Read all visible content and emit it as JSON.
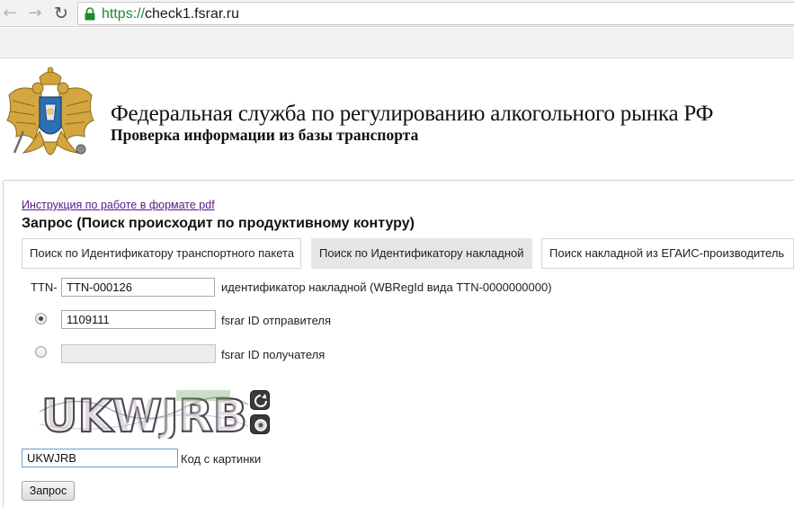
{
  "browser": {
    "url_protocol": "https://",
    "url_host": "check1.fsrar.ru",
    "icons": [
      "back-arrow-icon",
      "forward-arrow-icon",
      "reload-icon",
      "lock-icon"
    ],
    "secure_color": "#1e8a2e"
  },
  "header": {
    "agency_title": "Федеральная служба по регулированию алкогольного рынка РФ",
    "agency_subtitle": "Проверка информации из базы транспорта",
    "emblem_icon": "coat-of-arms-icon"
  },
  "form": {
    "pdf_link": "Инструкция по работе в формате pdf",
    "query_title": "Запрос (Поиск происходит по продуктивному контуру)",
    "tabs": [
      {
        "label": "Поиск по Идентификатору транспортного пакета",
        "active": false
      },
      {
        "label": "Поиск по Идентификатору накладной",
        "active": true
      },
      {
        "label": "Поиск накладной из ЕГАИС-производитель",
        "active": false
      }
    ],
    "ttn_prefix": "TTN-",
    "ttn_value": "TTN-000126",
    "ttn_hint": "идентификатор накладной (WBRegId вида TTN-0000000000)",
    "sender": {
      "value": "1109111",
      "label": "fsrar ID отправителя",
      "selected": true
    },
    "receiver": {
      "value": "",
      "label": "fsrar ID получателя",
      "selected": false
    },
    "captcha": {
      "image_text": "UKWJRB",
      "refresh_icon": "refresh-icon",
      "audio_icon": "audio-icon"
    },
    "captcha_value": "UKWJRB",
    "captcha_label": "Код с картинки",
    "submit_label": "Запрос"
  },
  "colors": {
    "link": "#551a8b",
    "active_tab_bg": "#e6e6e6",
    "focus_border": "#6a9ed6"
  }
}
